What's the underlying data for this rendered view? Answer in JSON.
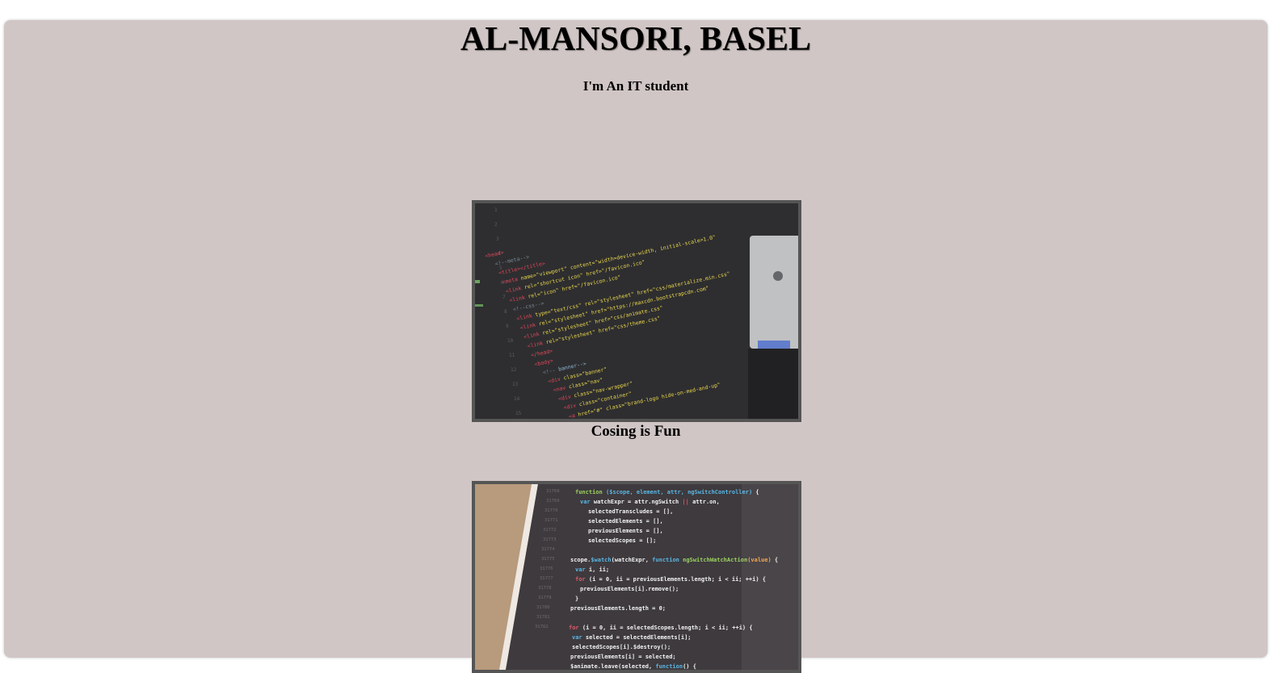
{
  "header": {
    "name": "AL-MANSORI, BASEL",
    "tagline": "I'm An IT student"
  },
  "gallery": [
    {
      "caption": "Cosing is Fun",
      "image": "code-editor-html-photo"
    },
    {
      "caption": "",
      "image": "code-editor-javascript-photo"
    }
  ],
  "colors": {
    "panel_bg": "#d0c6c5",
    "frame_border": "#555555"
  }
}
